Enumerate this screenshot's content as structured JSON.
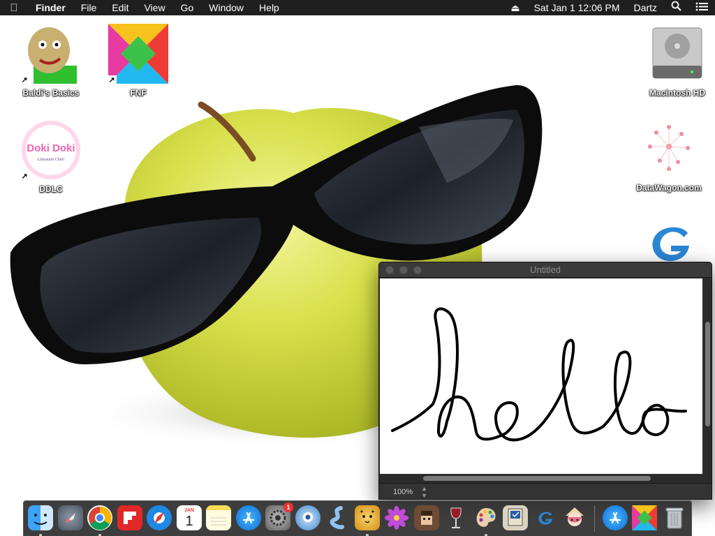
{
  "menubar": {
    "app_name": "Finder",
    "items": [
      "File",
      "Edit",
      "View",
      "Go",
      "Window",
      "Help"
    ],
    "clock": "Sat Jan 1  12:06 PM",
    "user": "Dartz",
    "icons": [
      "apple-logo-icon",
      "eject-icon",
      "search-icon",
      "list-icon"
    ]
  },
  "desktop": {
    "icons_left": [
      {
        "label": "Baldi's Basics",
        "icon": "baldi-icon",
        "alias": true
      },
      {
        "label": "FNF",
        "icon": "fnf-icon",
        "alias": true
      },
      {
        "label": "DDLC",
        "icon": "ddlc-icon",
        "alias": true,
        "art_text": "Doki Doki",
        "art_subtext": "Literature Club!"
      }
    ],
    "icons_right": [
      {
        "label": "Macintosh HD",
        "icon": "hard-drive-icon"
      },
      {
        "label": "DataWagon.com",
        "icon": "network-icon"
      },
      {
        "label": "",
        "icon": "gdevelop-icon"
      }
    ]
  },
  "window": {
    "title": "Untitled",
    "canvas_text": "hello",
    "zoom": "100%"
  },
  "dock": {
    "items": [
      {
        "name": "finder-icon",
        "running": true
      },
      {
        "name": "launchpad-icon",
        "running": false
      },
      {
        "name": "chrome-icon",
        "running": true
      },
      {
        "name": "flipboard-icon",
        "running": false
      },
      {
        "name": "safari-icon",
        "running": false
      },
      {
        "name": "calendar-icon",
        "running": false,
        "month": "JAN",
        "day": "1"
      },
      {
        "name": "notes-icon",
        "running": false
      },
      {
        "name": "app-store-icon",
        "running": false
      },
      {
        "name": "system-preferences-icon",
        "running": false,
        "badge": "1"
      },
      {
        "name": "webcam-icon",
        "running": false
      },
      {
        "name": "scrivener-icon",
        "running": false
      },
      {
        "name": "cheetah-icon",
        "running": true
      },
      {
        "name": "flower-icon",
        "running": false
      },
      {
        "name": "character-app-icon",
        "running": false
      },
      {
        "name": "wine-icon",
        "running": false
      },
      {
        "name": "paint-palette-icon",
        "running": true
      },
      {
        "name": "classic-mac-icon",
        "running": false
      },
      {
        "name": "gdevelop-dock-icon",
        "running": false
      },
      {
        "name": "anime-avatar-icon",
        "running": false
      },
      {
        "name": "app-store-2-icon",
        "running": false
      },
      {
        "name": "fnf-dock-icon",
        "running": false
      },
      {
        "name": "trash-icon",
        "running": false
      }
    ]
  }
}
